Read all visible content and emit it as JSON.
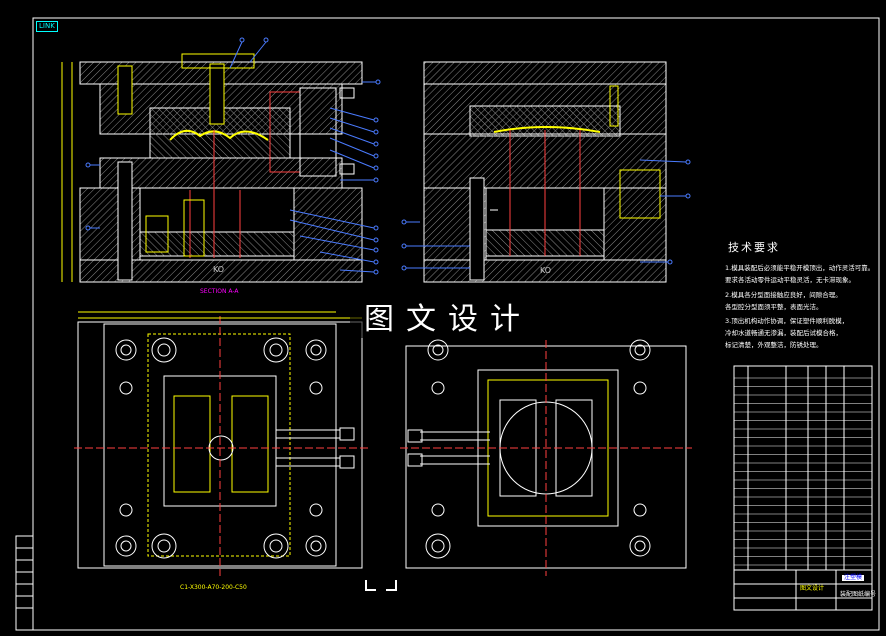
{
  "drawing": {
    "tag": "LINK",
    "section_label": "SECTION A-A",
    "ejector_label_left": "KO",
    "ejector_label_right": "KO",
    "watermark": "图文设计",
    "section_view_label": "C1-X300-A70-200-C50"
  },
  "requirements": {
    "title": "技术要求",
    "lines": [
      "1.模具装配后必须能平稳开模顶出，动作灵活可靠。",
      "要求各活动零件运动平稳灵活，无卡滞现象。",
      "2.模具各分型面接触应良好，间隙合理。",
      "各型腔分型面须平整，表面光洁。",
      "3.顶出机构动作协调，保证塑件顺利脱模，",
      "冷却水道畅通无渗漏，装配后试模合格，",
      "标记清楚，外观整洁，防锈处理。"
    ]
  },
  "title_block": {
    "school": "图文设计",
    "drawing_name": "注塑模",
    "drawing_number": "装配图纸编号"
  },
  "colors": {
    "background": "#000000",
    "outline": "#ffffff",
    "hatch": "#8a8a8a",
    "callout": "#4a7bff",
    "core": "#ffff00",
    "pins": "#ff4040",
    "dims": "#ff00ff",
    "cyan": "#00ffff"
  }
}
